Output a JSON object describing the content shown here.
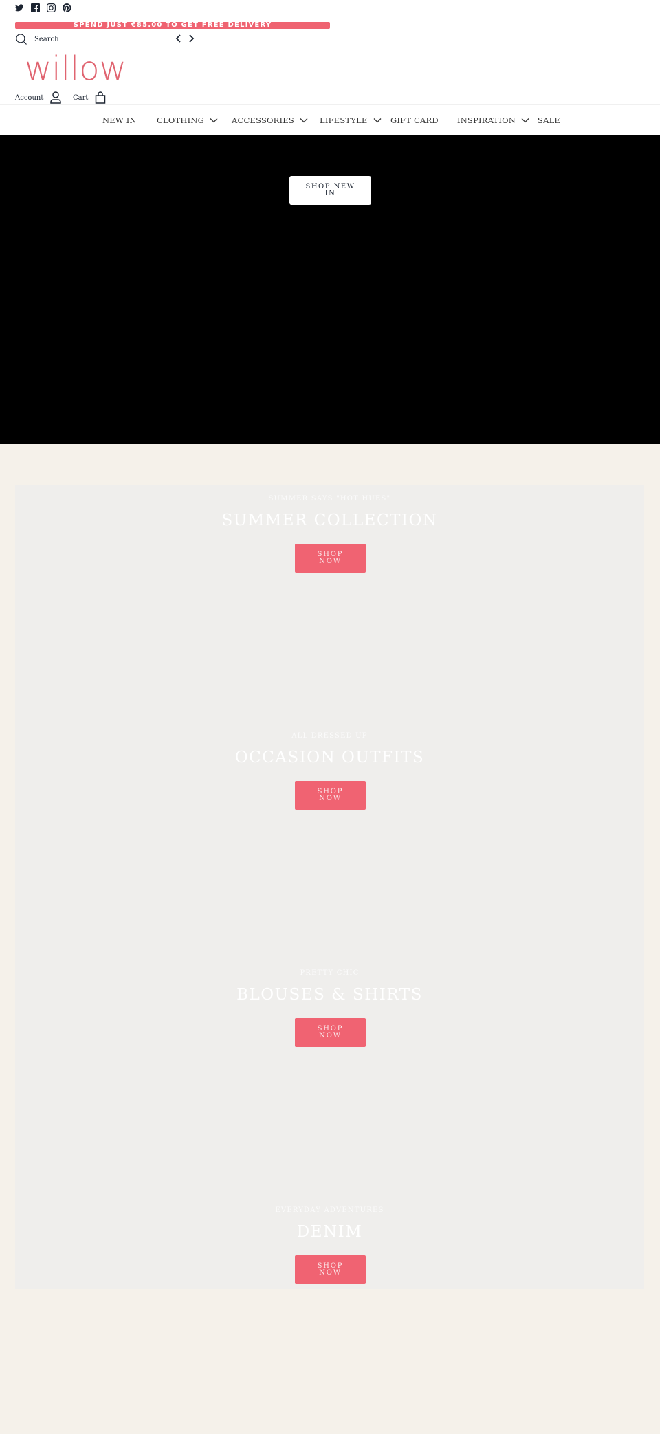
{
  "social": [
    {
      "name": "twitter-icon"
    },
    {
      "name": "facebook-icon"
    },
    {
      "name": "instagram-icon"
    },
    {
      "name": "pinterest-icon"
    }
  ],
  "announcement": {
    "text": "SPEND JUST €85.00 TO GET FREE DELIVERY",
    "color": "#ef6371"
  },
  "header": {
    "search_label": "Search",
    "logo": "willow",
    "account_label": "Account",
    "cart_label": "Cart"
  },
  "nav": {
    "items": [
      {
        "label": "NEW IN",
        "dropdown": false
      },
      {
        "label": "CLOTHING",
        "dropdown": true
      },
      {
        "label": "ACCESSORIES",
        "dropdown": true
      },
      {
        "label": "LIFESTYLE",
        "dropdown": true
      },
      {
        "label": "GIFT CARD",
        "dropdown": false
      },
      {
        "label": "INSPIRATION",
        "dropdown": true
      },
      {
        "label": "SALE",
        "dropdown": false
      }
    ]
  },
  "hero": {
    "button_label": "SHOP NEW IN"
  },
  "collections": [
    {
      "eyebrow": "SUMMER SAYS \"HOT HUES\"",
      "title": "SUMMER COLLECTION",
      "button": "SHOP NOW"
    },
    {
      "eyebrow": "ALL DRESSED UP",
      "title": "OCCASION OUTFITS",
      "button": "SHOP NOW"
    },
    {
      "eyebrow": "PRETTY CHIC",
      "title": "BLOUSES & SHIRTS",
      "button": "SHOP NOW"
    },
    {
      "eyebrow": "EVERYDAY ADVENTURES",
      "title": "DENIM",
      "button": "SHOP NOW"
    }
  ],
  "colors": {
    "accent": "#f06372",
    "logo": "#e06470",
    "page_background": "#f5f1ea",
    "tile_background": "#efeeec"
  }
}
